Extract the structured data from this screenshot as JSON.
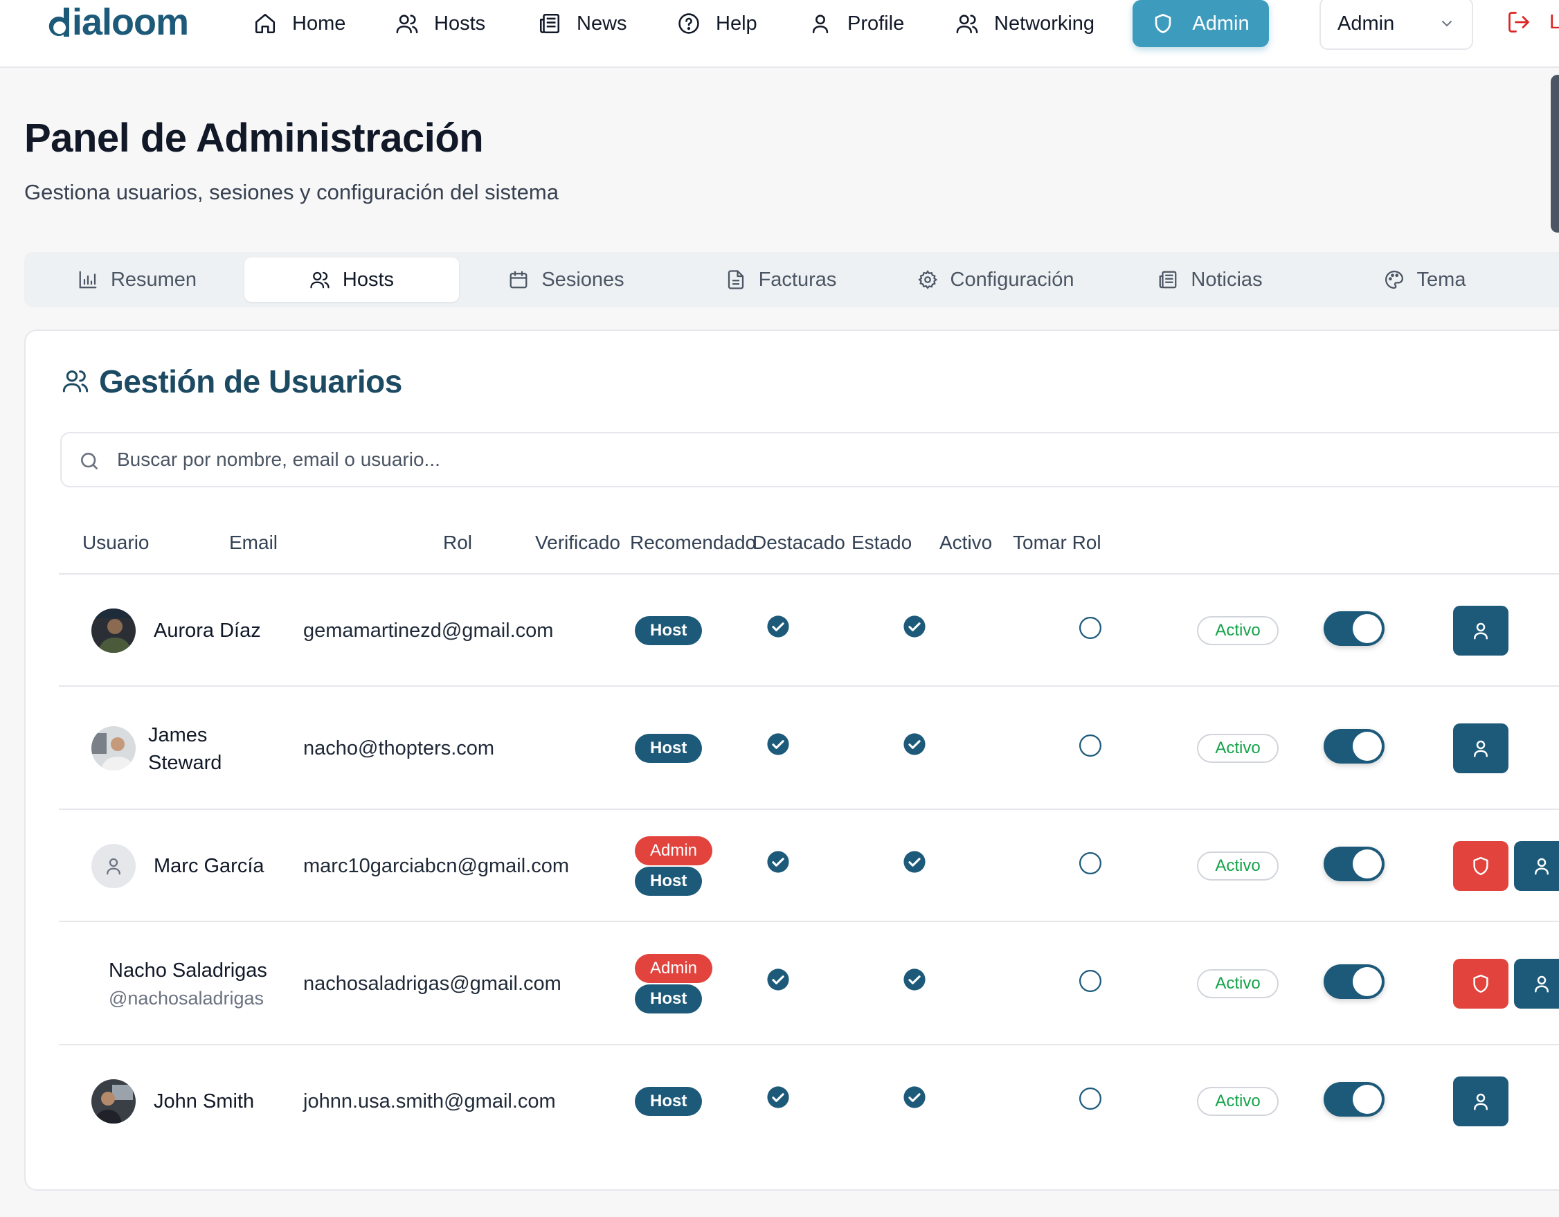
{
  "brand": {
    "name": "ialoom"
  },
  "nav": {
    "home": "Home",
    "hosts": "Hosts",
    "news": "News",
    "help": "Help",
    "profile": "Profile",
    "networking": "Networking",
    "admin": "Admin"
  },
  "role_select": {
    "value": "Admin"
  },
  "logout": {
    "label": "L"
  },
  "page": {
    "title": "Panel de Administración",
    "subtitle": "Gestiona usuarios, sesiones y configuración del sistema"
  },
  "tabs": [
    {
      "label": "Resumen",
      "icon": "bar-chart-icon"
    },
    {
      "label": "Hosts",
      "icon": "users-icon",
      "active": true
    },
    {
      "label": "Sesiones",
      "icon": "calendar-icon"
    },
    {
      "label": "Facturas",
      "icon": "file-text-icon"
    },
    {
      "label": "Configuración",
      "icon": "gear-icon"
    },
    {
      "label": "Noticias",
      "icon": "newspaper-icon"
    },
    {
      "label": "Tema",
      "icon": "palette-icon"
    }
  ],
  "section": {
    "title": "Gestión de Usuarios"
  },
  "search": {
    "placeholder": "Buscar por nombre, email o usuario...",
    "value": ""
  },
  "table": {
    "headers": [
      "Usuario",
      "Email",
      "Rol",
      "Verificado",
      "Recomendado",
      "Destacado",
      "Estado",
      "Activo",
      "Tomar Rol"
    ],
    "rows": [
      {
        "name": "Aurora Díaz",
        "email": "gemamartinezd@gmail.com",
        "roles": [
          "Host"
        ],
        "verified": true,
        "recommended": true,
        "featured": false,
        "status": "Activo",
        "active": true
      },
      {
        "name_line1": "James",
        "name_line2": "Steward",
        "email": "nacho@thopters.com",
        "roles": [
          "Host"
        ],
        "verified": true,
        "recommended": true,
        "featured": false,
        "status": "Activo",
        "active": true
      },
      {
        "name": "Marc García",
        "email": "marc10garciabcn@gmail.com",
        "roles": [
          "Admin",
          "Host"
        ],
        "verified": true,
        "recommended": true,
        "featured": false,
        "status": "Activo",
        "active": true
      },
      {
        "name": "Nacho Saladrigas",
        "handle": "@nachosaladrigas",
        "email": "nachosaladrigas@gmail.com",
        "roles": [
          "Admin",
          "Host"
        ],
        "verified": true,
        "recommended": true,
        "featured": false,
        "status": "Activo",
        "active": true
      },
      {
        "name": "John Smith",
        "email": "johnn.usa.smith@gmail.com",
        "roles": [
          "Host"
        ],
        "verified": true,
        "recommended": true,
        "featured": false,
        "status": "Activo",
        "active": true
      }
    ]
  },
  "colors": {
    "brand": "#1d5a7a",
    "accent": "#3d9bbd",
    "admin_badge": "#e2433d",
    "status_active": "#16a34a"
  }
}
